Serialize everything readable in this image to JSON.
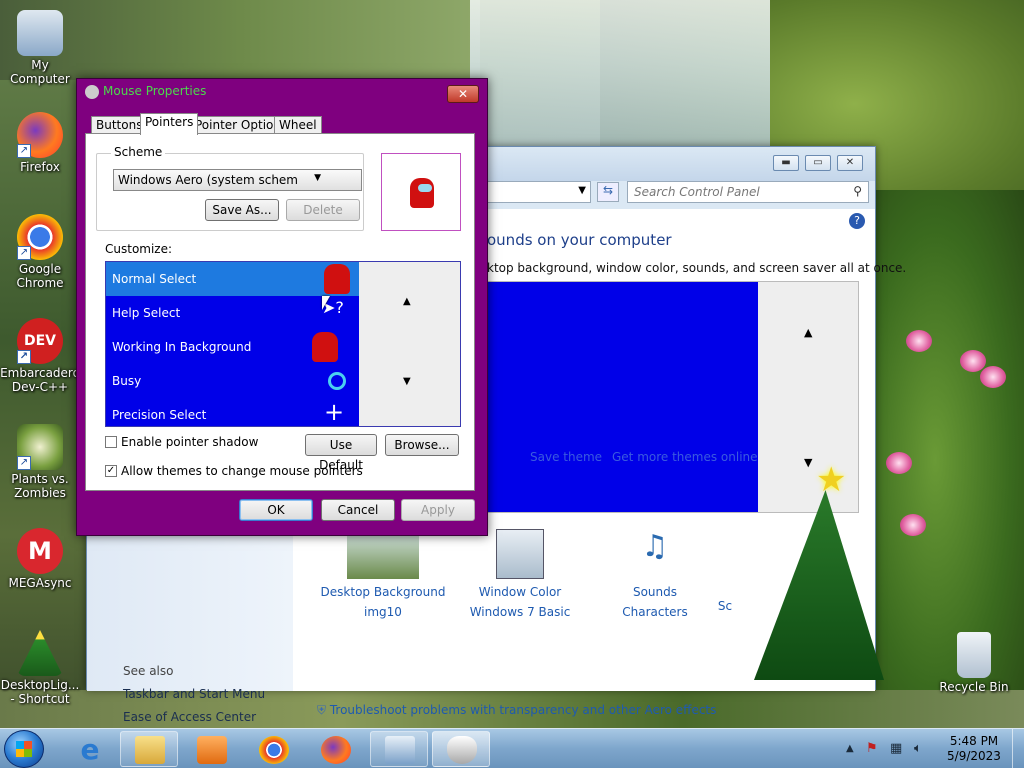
{
  "desktop": {
    "icons": [
      {
        "label": "My Computer"
      },
      {
        "label": "Firefox"
      },
      {
        "label": "Google Chrome"
      },
      {
        "label": "Embarcadero Dev-C++"
      },
      {
        "label": "Plants vs. Zombies"
      },
      {
        "label": "MEGAsync"
      },
      {
        "label": "DesktopLig... - Shortcut"
      },
      {
        "label": "Recycle Bin"
      }
    ]
  },
  "control_panel": {
    "search_placeholder": "Search Control Panel",
    "heading": "ounds on your computer",
    "subheading": "ktop background, window color, sounds, and screen saver all at once.",
    "theme_links": {
      "save": "Save theme",
      "more": "Get more themes online"
    },
    "items": [
      {
        "link": "Desktop Background",
        "sub": "img10"
      },
      {
        "link": "Window Color",
        "sub": "Windows 7 Basic"
      },
      {
        "link": "Sounds",
        "sub": "Characters"
      },
      {
        "link": "Sc",
        "sub": ""
      }
    ],
    "see_also": "See also",
    "see_links": [
      "Taskbar and Start Menu",
      "Ease of Access Center"
    ],
    "troubleshoot": "Troubleshoot problems with transparency and other Aero effects"
  },
  "dialog": {
    "title": "Mouse Properties",
    "close": "✕",
    "tabs": [
      "Buttons",
      "Pointers",
      "Pointer Options",
      "Wheel"
    ],
    "scheme_label": "Scheme",
    "scheme_value": "Windows Aero (system schem",
    "save_as": "Save As...",
    "delete": "Delete",
    "customize_label": "Customize:",
    "pointers": [
      {
        "name": "Normal Select",
        "selected": true
      },
      {
        "name": "Help Select",
        "selected": false
      },
      {
        "name": "Working In Background",
        "selected": false
      },
      {
        "name": "Busy",
        "selected": false
      },
      {
        "name": "Precision Select",
        "selected": false
      }
    ],
    "enable_shadow": {
      "label": "Enable pointer shadow",
      "checked": false
    },
    "allow_themes": {
      "label": "Allow themes to change mouse pointers",
      "checked": true
    },
    "use_default": "Use Default",
    "browse": "Browse...",
    "ok": "OK",
    "cancel": "Cancel",
    "apply": "Apply"
  },
  "taskbar": {
    "time": "5:48 PM",
    "date": "5/9/2023"
  }
}
